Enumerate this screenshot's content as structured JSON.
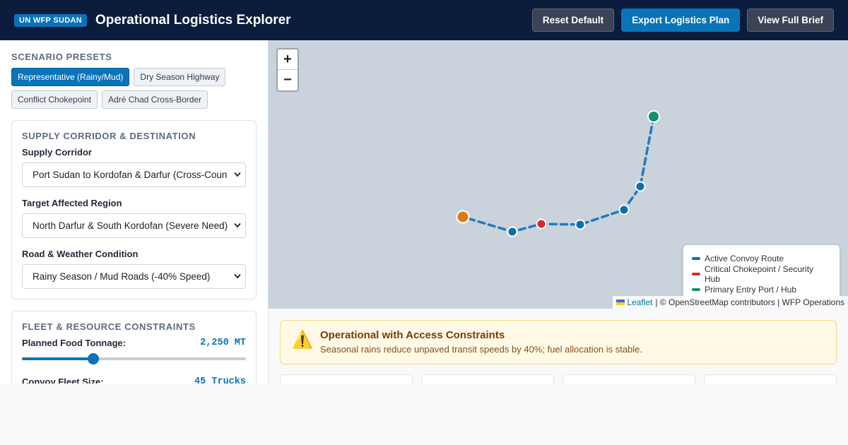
{
  "header": {
    "badge": "UN WFP SUDAN",
    "title": "Operational Logistics Explorer",
    "buttons": {
      "reset": "Reset Default",
      "export": "Export Logistics Plan",
      "brief": "View Full Brief"
    }
  },
  "sidebar": {
    "presets_heading": "SCENARIO PRESETS",
    "presets": [
      "Representative (Rainy/Mud)",
      "Dry Season Highway",
      "Conflict Chokepoint",
      "Adré Chad Cross-Border"
    ],
    "corridor_panel": {
      "heading": "SUPPLY CORRIDOR & DESTINATION",
      "fields": [
        {
          "label": "Supply Corridor",
          "value": "Port Sudan to Kordofan & Darfur (Cross-Country)"
        },
        {
          "label": "Target Affected Region",
          "value": "North Darfur & South Kordofan (Severe Need)"
        },
        {
          "label": "Road & Weather Condition",
          "value": "Rainy Season / Mud Roads (-40% Speed)"
        }
      ]
    },
    "fleet_panel": {
      "heading": "FLEET & RESOURCE CONSTRAINTS",
      "tonnage_label": "Planned Food Tonnage:",
      "tonnage_value": "2,250 MT",
      "tonnage_fraction": 0.32,
      "fleet_label": "Convoy Fleet Size:",
      "fleet_value": "45 Trucks"
    }
  },
  "map": {
    "zoom_in": "+",
    "zoom_out": "−",
    "legend": [
      {
        "label": "Active Convoy Route",
        "color": "#0a74b8"
      },
      {
        "label": "Critical Chokepoint / Security Hub",
        "color": "#d62b2b"
      },
      {
        "label": "Primary Entry Port / Hub",
        "color": "#13906f"
      }
    ],
    "attribution_link": "Leaflet",
    "attribution_text": "| © OpenStreetMap contributors | WFP Operations",
    "colors": {
      "route": "#1f7bbf",
      "destination": "#d97a14",
      "chokepoint": "#d62b2b",
      "port": "#13906f",
      "waypoint": "#0a6fb0"
    }
  },
  "status": {
    "title": "Operational with Access Constraints",
    "text": "Seasonal rains reduce unpaved transit speeds by 40%; fuel allocation is stable."
  }
}
